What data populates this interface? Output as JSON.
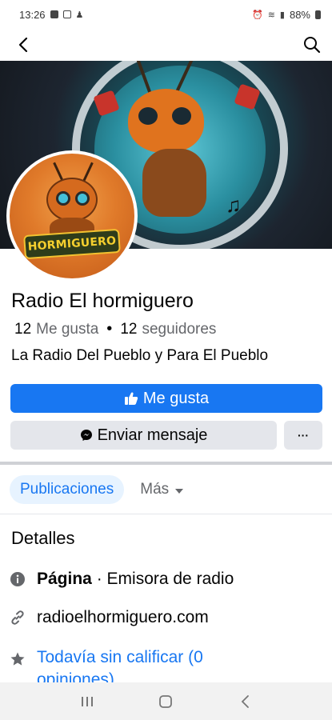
{
  "status_bar": {
    "time": "13:26",
    "battery": "88%"
  },
  "page": {
    "name": "Radio El hormiguero",
    "likes_count": "12",
    "likes_label": "Me gusta",
    "followers_count": "12",
    "followers_label": "seguidores",
    "bio": "La Radio Del Pueblo y Para El Pueblo",
    "avatar_logo_text": "HORMIGUERO"
  },
  "actions": {
    "like_label": "Me gusta",
    "message_label": "Enviar mensaje",
    "more_label": "···"
  },
  "tabs": {
    "active_label": "Publicaciones",
    "more_label": "Más"
  },
  "details": {
    "title": "Detalles",
    "category_prefix": "Página",
    "category_value": "· Emisora de radio",
    "website": "radioelhormiguero.com",
    "rating_line1": "Todavía sin calificar (0",
    "rating_line2": "opiniones)"
  },
  "colors": {
    "accent": "#1877f2",
    "button_gray": "#e4e6eb",
    "text_secondary": "#65676b"
  },
  "icons": {
    "back": "arrow-left-icon",
    "search": "search-icon",
    "like": "thumbs-up-icon",
    "messenger": "messenger-icon",
    "info": "info-icon",
    "link": "link-icon",
    "star": "star-icon"
  }
}
